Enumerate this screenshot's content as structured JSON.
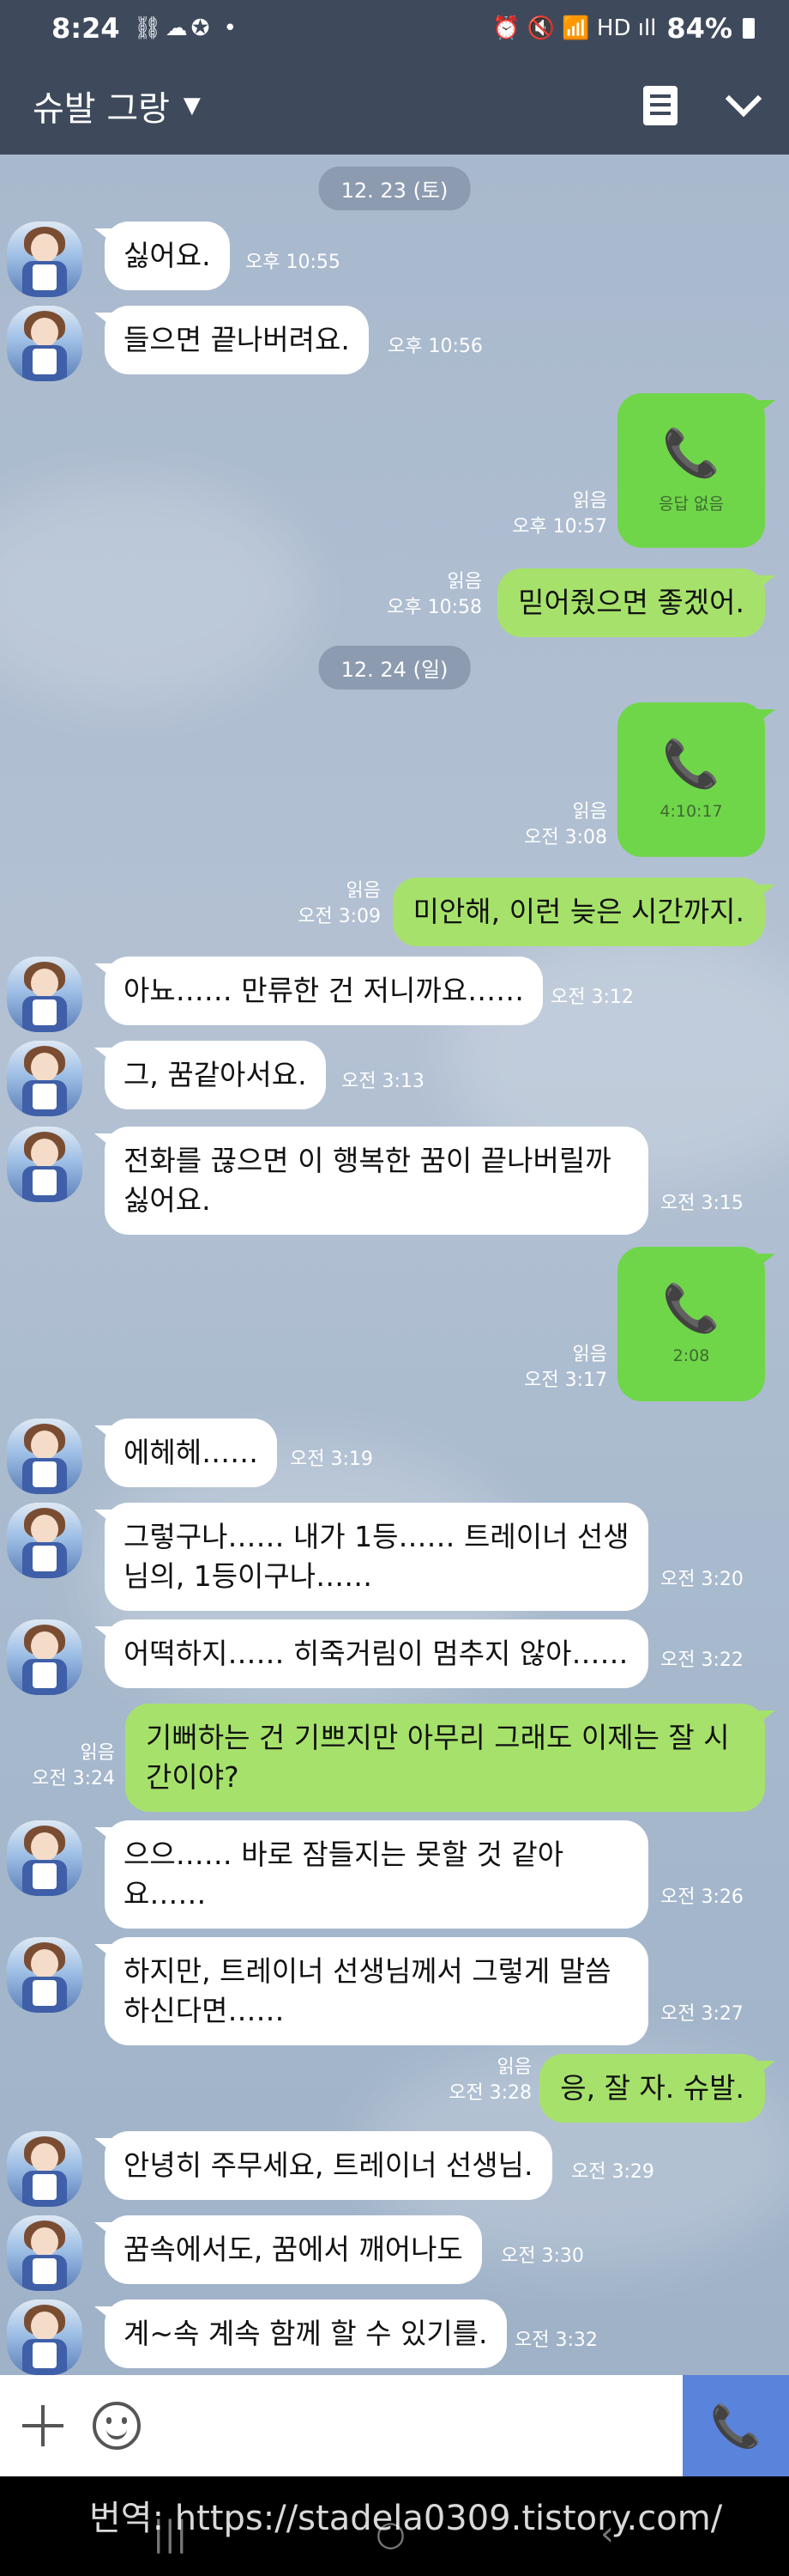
{
  "status_bar": {
    "time": "8:24",
    "left_icons": "⛓☁✪ •",
    "right_icons": "⏰ 🔇 📶 HD ıll",
    "battery": "84%"
  },
  "header": {
    "title": "슈발 그랑",
    "caret": "▼"
  },
  "dates": {
    "d1": "12. 23 (토)",
    "d2": "12. 24 (일)"
  },
  "messages": {
    "m1": {
      "text": "싫어요.",
      "time": "오후 10:55"
    },
    "m2": {
      "text": "들으면 끝나버려요.",
      "time": "오후 10:56"
    },
    "c1": {
      "label": "응답 없음",
      "read": "읽음",
      "time": "오후 10:57"
    },
    "o1": {
      "text": "믿어줬으면 좋겠어.",
      "read": "읽음",
      "time": "오후 10:58"
    },
    "c2": {
      "label": "4:10:17",
      "read": "읽음",
      "time": "오전 3:08"
    },
    "o2": {
      "text": "미안해, 이런 늦은 시간까지.",
      "read": "읽음",
      "time": "오전 3:09"
    },
    "m3": {
      "text": "아뇨…… 만류한 건 저니까요……",
      "time": "오전 3:12"
    },
    "m4": {
      "text": "그, 꿈같아서요.",
      "time": "오전 3:13"
    },
    "m5": {
      "text": "전화를 끊으면 이 행복한 꿈이 끝나버릴까\n싫어요.",
      "time": "오전 3:15"
    },
    "c3": {
      "label": "2:08",
      "read": "읽음",
      "time": "오전 3:17"
    },
    "m6": {
      "text": "에헤헤……",
      "time": "오전 3:19"
    },
    "m7": {
      "text": "그렇구나…… 내가 1등…… 트레이너 선생\n님의, 1등이구나……",
      "time": "오전 3:20"
    },
    "m8": {
      "text": "어떡하지…… 히죽거림이 멈추지 않아……",
      "time": "오전 3:22"
    },
    "o3": {
      "text": "기뻐하는 건 기쁘지만 아무리 그래도 이제는 잘 시\n간이야?",
      "read": "읽음",
      "time": "오전 3:24"
    },
    "m9": {
      "text": "으으…… 바로 잠들지는 못할 것 같아\n요……",
      "time": "오전 3:26"
    },
    "m10": {
      "text": "하지만, 트레이너 선생님께서 그렇게 말씀\n하신다면……",
      "time": "오전 3:27"
    },
    "o4": {
      "text": "응, 잘 자. 슈발.",
      "read": "읽음",
      "time": "오전 3:28"
    },
    "m11": {
      "text": "안녕히 주무세요, 트레이너 선생님.",
      "time": "오전 3:29"
    },
    "m12": {
      "text": "꿈속에서도, 꿈에서 깨어나도",
      "time": "오전 3:30"
    },
    "m13": {
      "text": "계~속 계속 함께 할 수 있기를.",
      "time": "오전 3:32"
    }
  },
  "input": {
    "placeholder": ""
  },
  "icons": {
    "phone": "📞",
    "call_button": "📞"
  },
  "watermark": "번역: https://stadela0309.tistory.com/",
  "colors": {
    "header_bg": "#3e4a5c",
    "chat_bg": "#a9b9cd",
    "incoming_bubble": "#ffffff",
    "outgoing_bubble": "#a6e26b",
    "call_bubble": "#6fd64a",
    "call_button": "#5a83dc"
  }
}
